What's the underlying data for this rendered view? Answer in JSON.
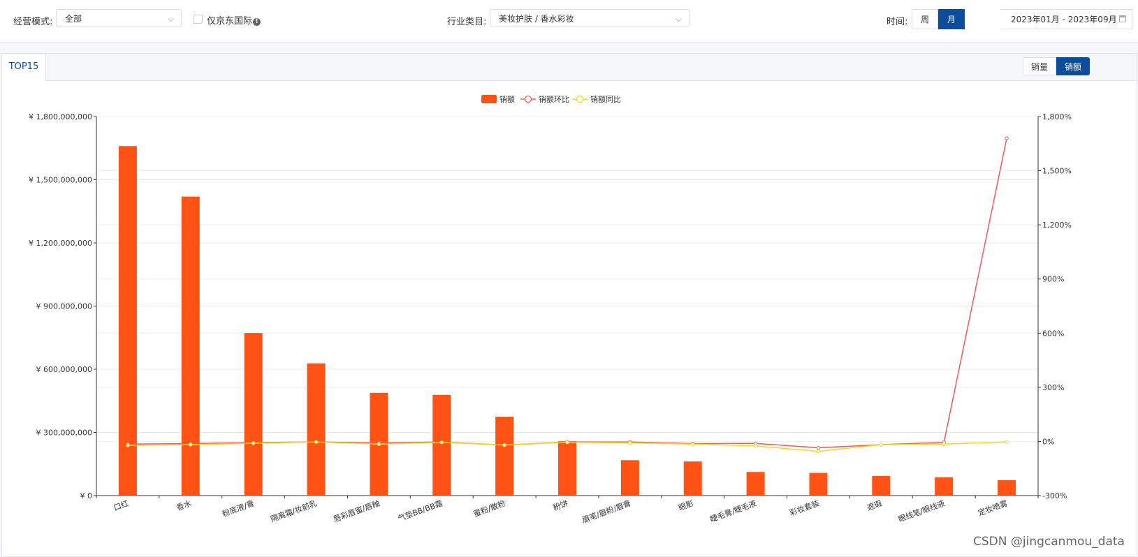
{
  "filters": {
    "mode_label": "经营模式:",
    "mode_value": "全部",
    "jd_only_label": "仅京东国际",
    "industry_label": "行业类目:",
    "industry_value": "美妆护肤 / 香水彩妆",
    "time_label": "时间:",
    "week_label": "周",
    "month_label": "月",
    "date_range": "2023年01月 - 2023年09月"
  },
  "tabs": {
    "active": "TOP15"
  },
  "toggle": {
    "volume": "销量",
    "amount": "销额"
  },
  "watermark": "CSDN @jingcanmou_data",
  "colors": {
    "bar": "#ff5316",
    "mom_line": "#ef5a5a",
    "yoy_line": "#f5d81c",
    "accent": "#0b4d9b"
  },
  "chart_data": {
    "type": "bar",
    "categories": [
      "口红",
      "香水",
      "粉底液/膏",
      "隔离霜/妆前乳",
      "唇彩唇蜜/唇釉",
      "气垫BB/BB霜",
      "蜜粉/散粉",
      "粉饼",
      "眉笔/眉粉/眉膏",
      "眼影",
      "睫毛膏/睫毛液",
      "彩妆套装",
      "遮瑕",
      "眼线笔/眼线液",
      "定妆喷雾"
    ],
    "series": [
      {
        "name": "销额",
        "type": "bar",
        "axis": "left",
        "values": [
          1660000000,
          1420000000,
          772000000,
          628000000,
          488000000,
          478000000,
          375000000,
          258000000,
          168000000,
          162000000,
          112000000,
          108000000,
          93000000,
          87000000,
          73000000
        ]
      },
      {
        "name": "销额环比",
        "type": "line",
        "axis": "right",
        "values": [
          -15,
          -12,
          -6,
          -3,
          -8,
          -3,
          -20,
          -3,
          -3,
          -12,
          -11,
          -35,
          -18,
          -5,
          1680
        ]
      },
      {
        "name": "销额同比",
        "type": "line",
        "axis": "right",
        "values": [
          -22,
          -18,
          -10,
          -3,
          -15,
          -5,
          -20,
          -5,
          -8,
          -15,
          -25,
          -55,
          -18,
          -15,
          -3
        ]
      }
    ],
    "ylim_left": [
      0,
      1800000000
    ],
    "yticks_left": [
      "¥ 0",
      "¥ 300,000,000",
      "¥ 600,000,000",
      "¥ 900,000,000",
      "¥ 1,200,000,000",
      "¥ 1,500,000,000",
      "¥ 1,800,000,000"
    ],
    "ylim_right": [
      -300,
      1800
    ],
    "yticks_right": [
      "-300%",
      "0%",
      "300%",
      "600%",
      "900%",
      "1,200%",
      "1,500%",
      "1,800%"
    ],
    "legend": "top-center",
    "grid": true
  }
}
